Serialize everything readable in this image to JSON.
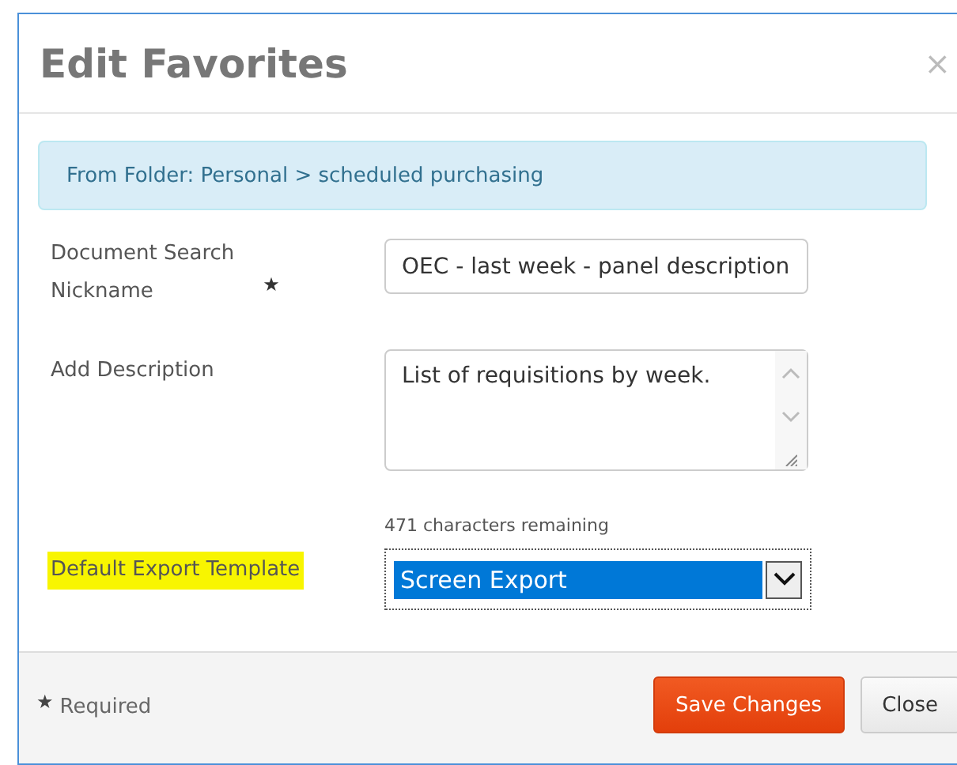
{
  "dialog": {
    "title": "Edit Favorites",
    "close": "×"
  },
  "alert": "From Folder: Personal > scheduled purchasing",
  "fields": [
    {
      "kind": "text",
      "label": "Document Search Nickname",
      "required_mark": "★",
      "value": "OEC - last week - panel description",
      "highlighted": false
    },
    {
      "kind": "textarea",
      "label": "Add Description",
      "value": "List of requisitions by week.",
      "hint": "471 characters remaining",
      "highlighted": false
    },
    {
      "kind": "select",
      "label": "Default Export Template",
      "value": "Screen Export",
      "highlighted": true
    }
  ],
  "footer": {
    "required_mark": "★",
    "required_note": "Required",
    "buttons": [
      {
        "label": "Save Changes",
        "kind": "primary"
      },
      {
        "label": "Close",
        "kind": "default"
      }
    ]
  }
}
